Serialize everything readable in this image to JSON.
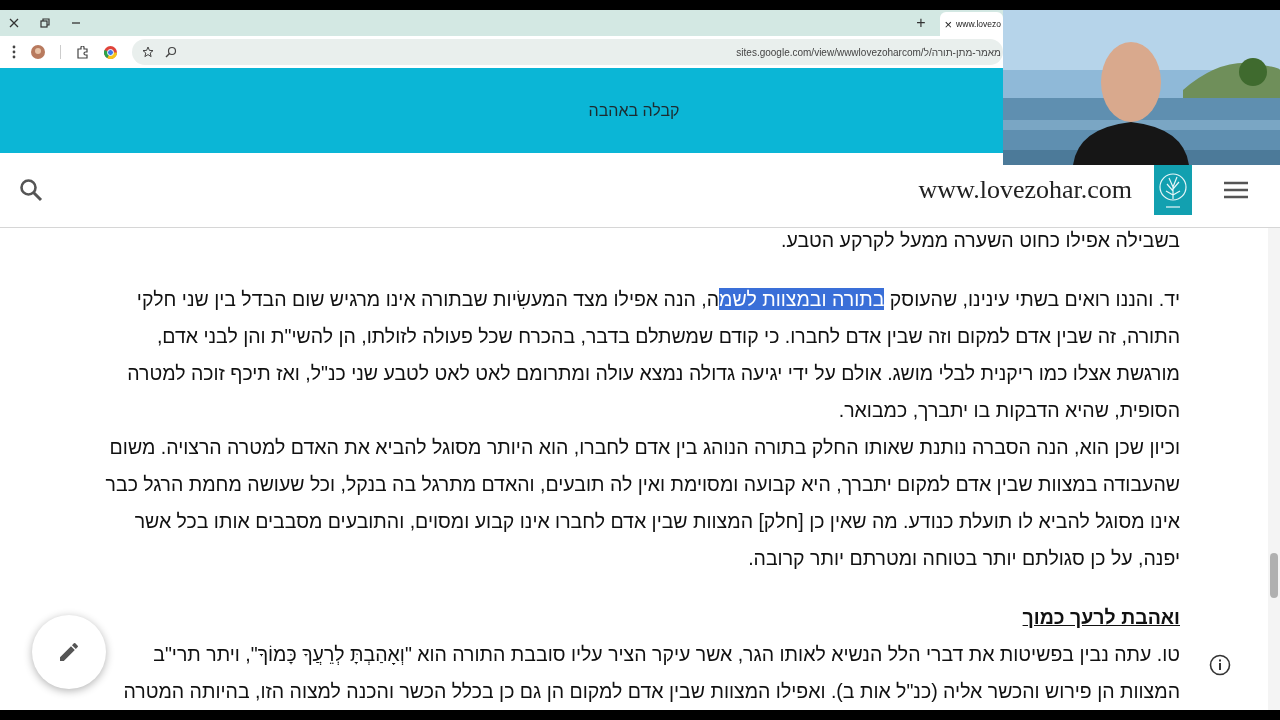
{
  "browser": {
    "new_tab": "+",
    "tab": {
      "close": "×",
      "title": "www.lovezo"
    },
    "address_bar": {
      "url": "sites.google.com/view/wwwlovezoharcom/מאמר-מתן-תורה/ל"
    }
  },
  "site": {
    "banner_title": "קבלה באהבה",
    "site_name": "www.lovezohar.com"
  },
  "sections": [
    {
      "blocks": [
        {
          "kind": "paragraph",
          "segments": [
            {
              "text": "בשבילה אפילו כחוט השערה ממעל לקרקע הטבע.",
              "highlighted": false
            }
          ]
        }
      ]
    },
    {
      "blocks": [
        {
          "kind": "paragraph",
          "segments": [
            {
              "text": "יד. והננו רואים בשתי עינינו, שהעוסק ",
              "highlighted": false
            },
            {
              "text": "בתורה ובמצוות לשמ",
              "highlighted": true
            },
            {
              "text": "ה, הנה אפילו מצד המעשִׂיות שבתורה אינו מרגיש שום הבדל בין שני חלקי התורה, זה שבין אדם למקום וזה שבין אדם לחברו. כי קודם שמשתלם בדבר, בהכרח שכל פעולה לזולתו, הן להשי\"ת והן לבני אדם, מורגשת אצלו כמו ריקנית לבלי מושג. אולם על ידי יגיעה גדולה נמצא עולה ומתרומם לאט לאט לטבע שני כנ\"ל, ואז תיכף זוכה למטרה הסופית, שהיא הדבקות בו יתברך, כמבואר.",
              "highlighted": false
            }
          ]
        },
        {
          "kind": "paragraph",
          "segments": [
            {
              "text": "וכיון שכן הוא, הנה הסברה נותנת שאותו החלק בתורה הנוהג בין אדם לחברו, הוא היותר מסוגל להביא את האדם למטרה הרצויה. משום שהעבודה במצוות שבין אדם למקום יתברך, היא קבועה ומסוימת ואין לה תובעים, והאדם מתרגל בה בנקל, וכל שעושה מחמת הרגל כבר אינו מסוגל להביא לו תועלת כנודע. מה שאין כן [חלק] המצוות שבין אדם לחברו אינו קבוע ומסוים, והתובעים מסבבים אותו בכל אשר יפנה, על כן סגולתם יותר בטוחה ומטרתם יותר קרובה.",
              "highlighted": false
            }
          ]
        }
      ]
    },
    {
      "blocks": [
        {
          "kind": "heading",
          "segments": [
            {
              "text": "ואהבת לרעך כמוך",
              "highlighted": false
            }
          ]
        },
        {
          "kind": "paragraph",
          "segments": [
            {
              "text": "טו. עתה נבין בפשיטות את דברי הלל הנשיא לאותו הגר, אשר עיקר הציר עליו סובבת התורה הוא \"וְאָהַבְתָּ לְרֵעֲךָ כָּמוֹךָ\", ויתר תרי\"ב המצוות הן פירוש והכשר אליה (כנ\"ל אות ב). ואפילו המצוות שבין אדם למקום הן גם כן בכלל הכשר והכנה למצוה הזו, בהיותה המטרה",
              "highlighted": false
            }
          ]
        }
      ]
    }
  ]
}
